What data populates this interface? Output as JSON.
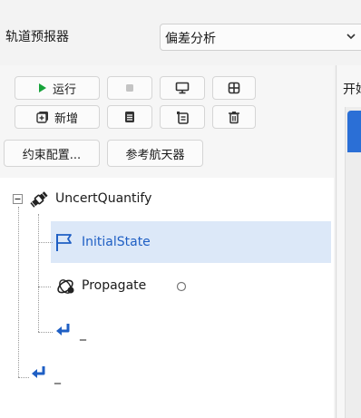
{
  "header": {
    "predictor_label": "轨道预报器",
    "mode_select": {
      "value": "偏差分析"
    }
  },
  "toolbar": {
    "run_label": "运行",
    "add_label": "新增",
    "constraint_config_label": "约束配置...",
    "reference_spacecraft_label": "参考航天器"
  },
  "right_panel": {
    "title": "开始"
  },
  "tree": {
    "root_label": "UncertQuantify",
    "items": [
      {
        "label": "InitialState",
        "selected": true
      },
      {
        "label": "Propagate",
        "selected": false
      },
      {
        "label": "_",
        "selected": false
      }
    ],
    "root_end_label": "_"
  },
  "colors": {
    "accent_blue": "#2b6fd6",
    "run_green": "#17a33a",
    "selection": "#dce8f8",
    "return_arrow": "#1f5fc4"
  }
}
